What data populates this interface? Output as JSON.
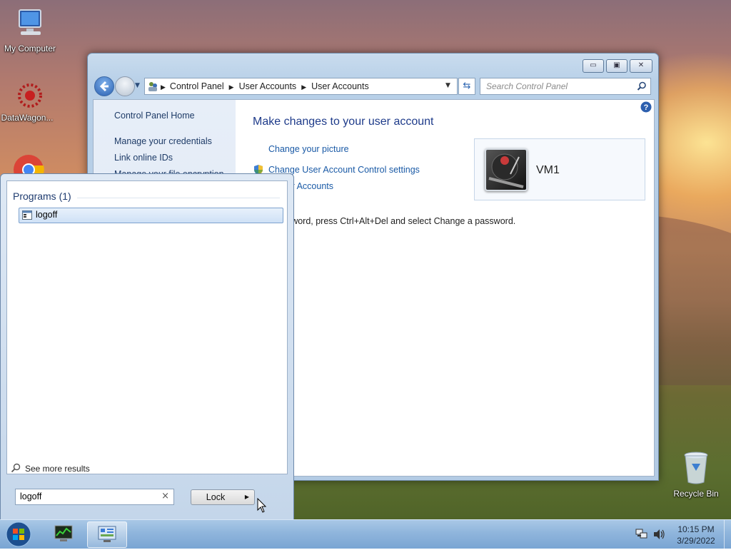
{
  "desktop": {
    "icons": [
      {
        "label": "My Computer",
        "icon": "computer-icon"
      },
      {
        "label": "DataWagon...",
        "icon": "datawagon-icon"
      },
      {
        "label": "Recycle Bin",
        "icon": "recycle-bin-icon"
      }
    ]
  },
  "window": {
    "breadcrumb": [
      "Control Panel",
      "User Accounts",
      "User Accounts"
    ],
    "search_placeholder": "Search Control Panel",
    "left_nav": [
      "Control Panel Home",
      "Manage your credentials",
      "Link online IDs",
      "Manage your file encryption"
    ],
    "heading": "Make changes to your user account",
    "tasks": [
      "Change your picture",
      "Change User Account Control settings",
      "e User Accounts"
    ],
    "password_note": "your password, press Ctrl+Alt+Del and select Change a password.",
    "user_name": "VM1"
  },
  "start_menu": {
    "section_header": "Programs (1)",
    "results": [
      {
        "label": "logoff",
        "icon": "program-icon"
      }
    ],
    "see_more": "See more results",
    "search_value": "logoff",
    "clear_glyph": "×",
    "power_button": "Lock",
    "power_arrow": "▶"
  },
  "taskbar": {
    "time": "10:15 PM",
    "date": "3/29/2022"
  },
  "colors": {
    "link": "#1a5aa6",
    "heading": "#1e3b8a",
    "taskbar": "#8fb5dc"
  }
}
